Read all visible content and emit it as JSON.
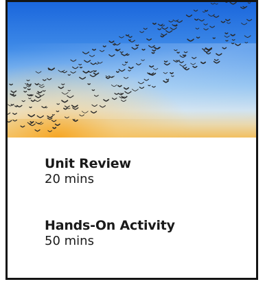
{
  "hero_image": {
    "icon": "flock-of-birds-sky-photo",
    "colors": {
      "sky_top": "#1e6fe0",
      "sky_mid": "#6fb0f2",
      "horizon_glow": "#f4a93a",
      "birds": "#2a2a2a"
    }
  },
  "activities": [
    {
      "title": "Unit Review",
      "duration": "20 mins"
    },
    {
      "title": "Hands-On Activity",
      "duration": "50 mins"
    }
  ],
  "colors": {
    "border": "#141414",
    "text": "#1a1a1a",
    "background": "#ffffff"
  }
}
